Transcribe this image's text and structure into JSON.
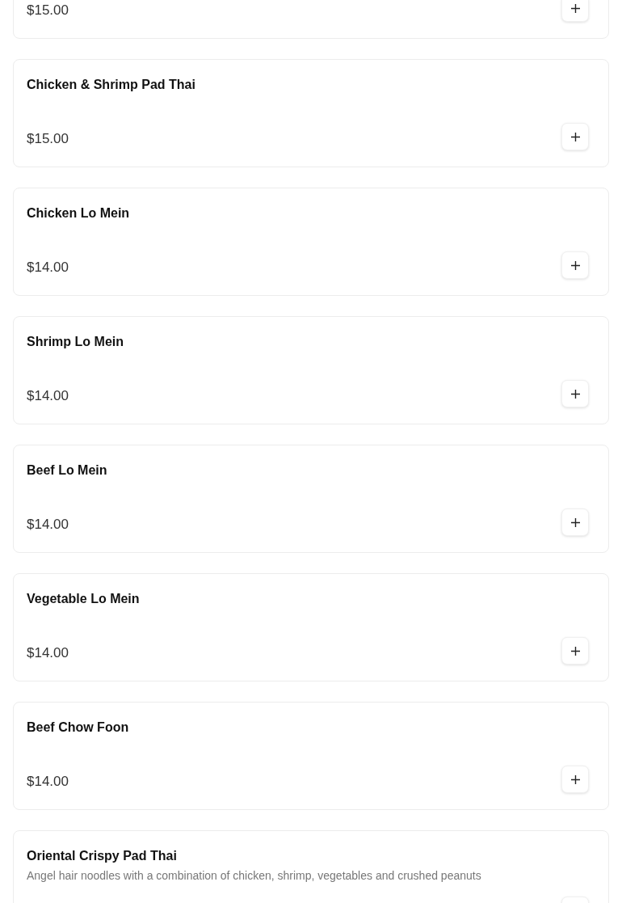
{
  "menu_items": [
    {
      "price": "$15.00"
    },
    {
      "name": "Chicken & Shrimp Pad Thai",
      "price": "$15.00"
    },
    {
      "name": "Chicken Lo Mein",
      "price": "$14.00"
    },
    {
      "name": "Shrimp Lo Mein",
      "price": "$14.00"
    },
    {
      "name": "Beef Lo Mein",
      "price": "$14.00"
    },
    {
      "name": "Vegetable Lo Mein",
      "price": "$14.00"
    },
    {
      "name": "Beef Chow Foon",
      "price": "$14.00"
    },
    {
      "name": "Oriental Crispy Pad Thai",
      "description": "Angel hair noodles with a combination of chicken, shrimp, vegetables and crushed peanuts"
    }
  ]
}
